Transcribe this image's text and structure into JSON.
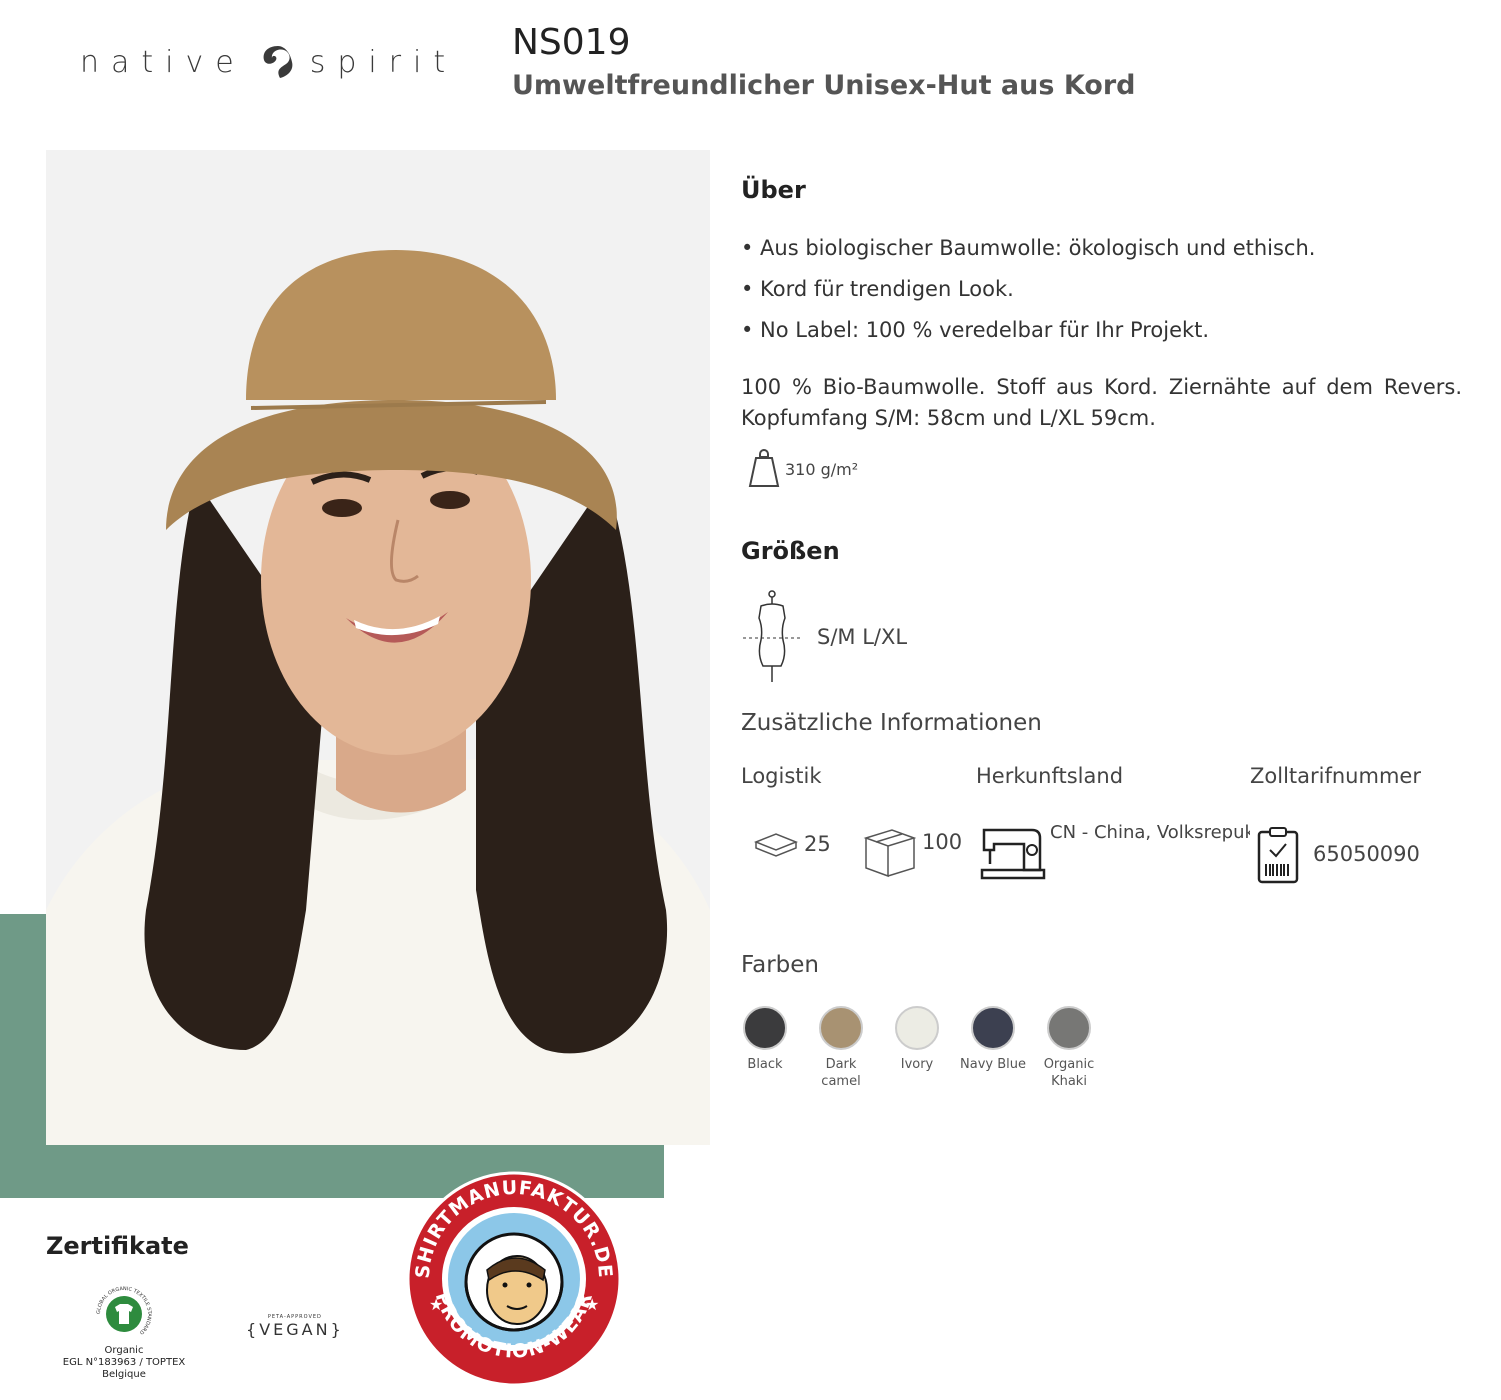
{
  "brand": {
    "left_word": "native",
    "right_word": "spirit"
  },
  "product": {
    "code": "NS019",
    "subtitle": "Umweltfreundlicher Unisex-Hut aus Kord"
  },
  "about": {
    "heading": "Über",
    "bullets": [
      "• Aus biologischer Baumwolle: ökologisch und ethisch.",
      "• Kord für trendigen Look.",
      "• No Label: 100 % veredelbar für Ihr Projekt."
    ],
    "description": "100 % Bio-Baumwolle. Stoff aus Kord. Ziernähte auf dem Revers. Kopfumfang S/M: 58cm und L/XL 59cm.",
    "weight": "310 g/m²"
  },
  "sizes": {
    "heading": "Größen",
    "values": "S/M L/XL"
  },
  "additional": {
    "heading": "Zusätzliche Informationen",
    "logistics_label": "Logistik",
    "origin_label": "Herkunftsland",
    "tariff_label": "Zolltarifnummer",
    "pack_small": "25",
    "pack_box": "100",
    "origin_value": "CN - China, Volksrepuk",
    "tariff_value": "65050090"
  },
  "colors": {
    "heading": "Farben",
    "items": [
      {
        "name": "Black",
        "hex": "#3b3b3d"
      },
      {
        "name": "Dark camel",
        "hex": "#a89272"
      },
      {
        "name": "Ivory",
        "hex": "#ecece4"
      },
      {
        "name": "Navy Blue",
        "hex": "#3c4050"
      },
      {
        "name": "Organic Khaki",
        "hex": "#777775"
      }
    ]
  },
  "certificates": {
    "heading": "Zertifikate",
    "gots_ring_text": "GLOBAL ORGANIC TEXTILE STANDARD",
    "gots_label": "Organic",
    "gots_sub": "EGL N°183963 / TOPTEX Belgique",
    "vegan_small": "PETA-APPROVED",
    "vegan": "VEGAN"
  },
  "badge": {
    "top": "SHIRTMANUFAKTUR.DE",
    "bottom": "PROMOTION-WEAR"
  },
  "accent_green": "#6f9a87"
}
